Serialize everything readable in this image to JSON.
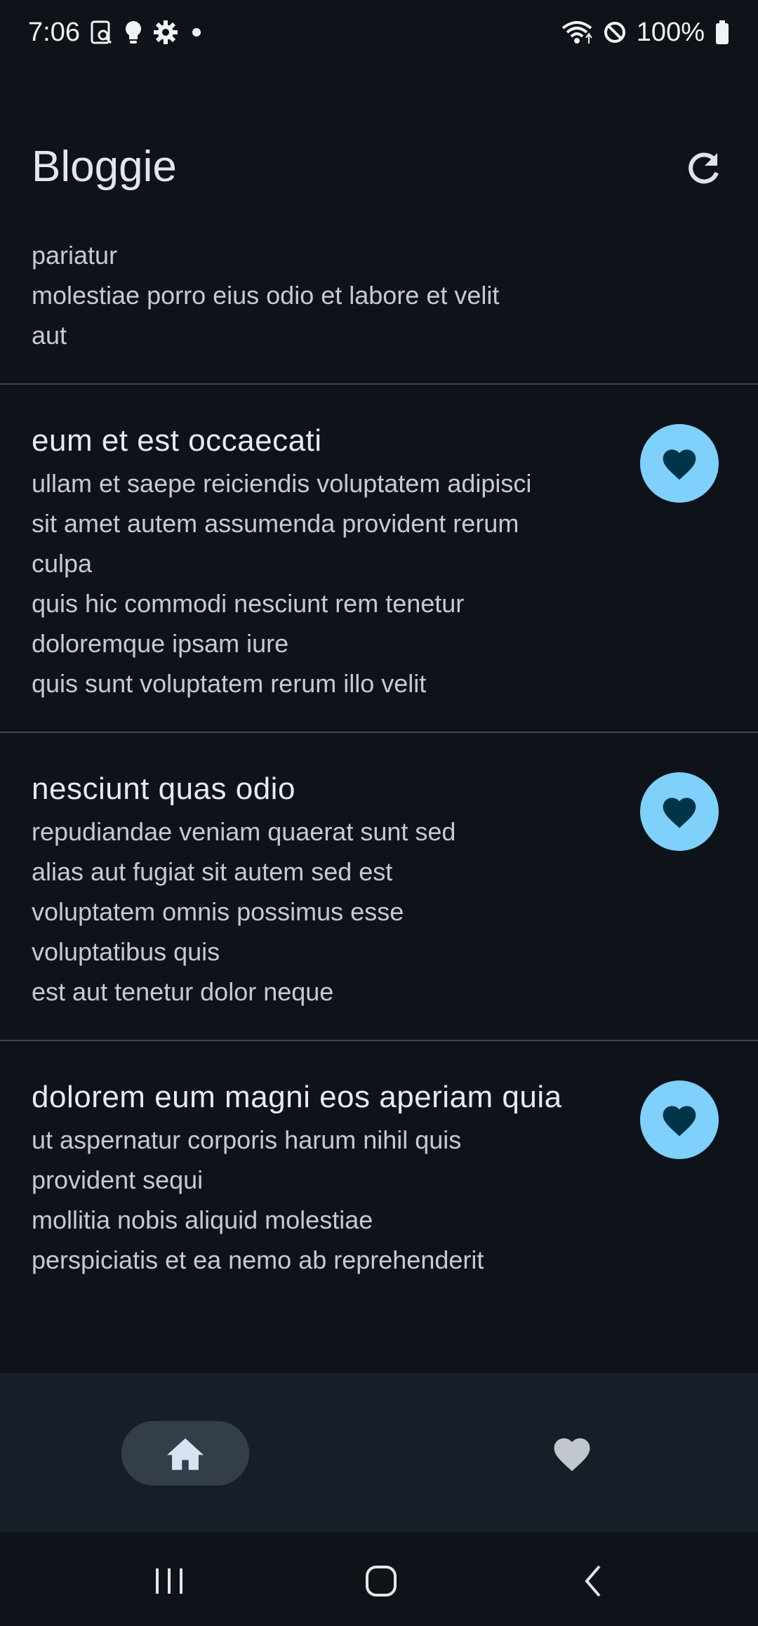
{
  "status_bar": {
    "time": "7:06",
    "battery": "100%",
    "left_icons": [
      "screenshot-search-icon",
      "bulb-icon",
      "gear-icon",
      "dot-icon"
    ],
    "right_icons": [
      "wifi-icon",
      "do-not-disturb-icon",
      "battery-icon"
    ]
  },
  "app_bar": {
    "title": "Bloggie",
    "refresh_icon": "refresh-icon"
  },
  "posts": [
    {
      "title": "",
      "lines": [
        "pariatur",
        "molestiae porro eius odio et labore et velit",
        "aut"
      ]
    },
    {
      "title": "eum et est occaecati",
      "lines": [
        "ullam et saepe reiciendis voluptatem adipisci",
        "sit amet autem assumenda provident rerum",
        "culpa",
        "quis hic commodi nesciunt rem tenetur",
        "doloremque ipsam iure",
        "quis sunt voluptatem rerum illo velit"
      ]
    },
    {
      "title": "nesciunt quas odio",
      "lines": [
        "repudiandae veniam quaerat sunt sed",
        "alias aut fugiat sit autem sed est",
        "voluptatem omnis possimus esse",
        "voluptatibus quis",
        "est aut tenetur dolor neque"
      ]
    },
    {
      "title": "dolorem eum magni eos aperiam quia",
      "lines": [
        "ut aspernatur corporis harum nihil quis",
        "provident sequi",
        "mollitia nobis aliquid molestiae",
        "perspiciatis et ea nemo ab reprehenderit"
      ]
    }
  ],
  "bottom_nav": {
    "items": [
      {
        "icon": "home-icon",
        "selected": true
      },
      {
        "icon": "heart-icon",
        "selected": false
      }
    ]
  },
  "system_nav": {
    "buttons": [
      "recents-icon",
      "home-circle-icon",
      "back-icon"
    ]
  },
  "colors": {
    "background": "#0e131a",
    "accent": "#7fd0fb",
    "heart_on_accent": "#003549",
    "nav_background": "#161f27",
    "nav_selected_pill": "#333e48"
  }
}
